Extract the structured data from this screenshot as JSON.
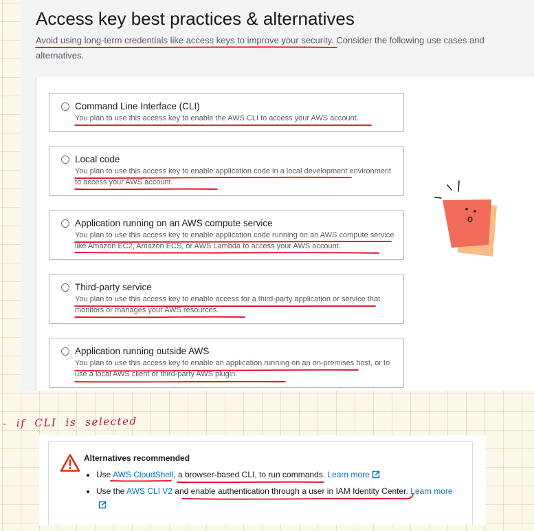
{
  "page": {
    "title": "Access key best practices & alternatives",
    "subtitle": "Avoid using long-term credentials like access keys to improve your security. Consider the following use cases and alternatives."
  },
  "options": [
    {
      "label": "Command Line Interface (CLI)",
      "description": "You plan to use this access key to enable the AWS CLI to access your AWS account.",
      "selected": false
    },
    {
      "label": "Local code",
      "description": "You plan to use this access key to enable application code in a local development environment to access your AWS account.",
      "selected": false
    },
    {
      "label": "Application running on an AWS compute service",
      "description": "You plan to use this access key to enable application code running on an AWS compute service like Amazon EC2, Amazon ECS, or AWS Lambda to access your AWS account.",
      "selected": false
    },
    {
      "label": "Third-party service",
      "description": "You plan to use this access key to enable access for a third-party application or service that monitors or manages your AWS resources.",
      "selected": false
    },
    {
      "label": "Application running outside AWS",
      "description": "You plan to use this access key to enable an application running on an on-premises host, or to use a local AWS client or third-party AWS plugin.",
      "selected": false
    }
  ],
  "annotation": {
    "note": "- if CLI is selected"
  },
  "alert": {
    "title": "Alternatives recommended",
    "items": [
      {
        "before": "Use ",
        "link": "AWS CloudShell",
        "after": ", a browser-based CLI, to run commands. ",
        "learn_more": "Learn more"
      },
      {
        "before": "Use the ",
        "link": "AWS CLI V2",
        "after": " and enable authentication through a user in IAM Identity Center. ",
        "learn_more": "Learn more"
      }
    ]
  },
  "icons": {
    "warning": "warning-icon",
    "external_link": "external-link-icon",
    "doodle": "sticky-note-doodle"
  },
  "colors": {
    "heading": "#16191f",
    "body_text": "#545b64",
    "link": "#0073bb",
    "warning": "#d13212",
    "annotation_ink": "#e2001a",
    "note_ink": "#b8123a",
    "sticky_front": "#f26a58",
    "sticky_back": "#f8bd87",
    "paper": "#fcf8e9",
    "console_bg": "#f2f3f3",
    "card_border": "#aab7b8"
  }
}
